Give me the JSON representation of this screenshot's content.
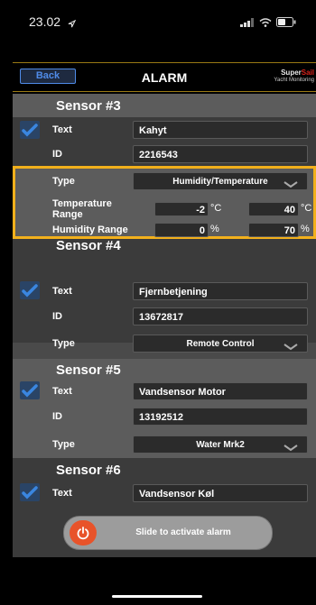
{
  "status": {
    "time": "23.02"
  },
  "nav": {
    "back_label": "Back",
    "title": "ALARM",
    "logo_super": "Super",
    "logo_sail": "Sail",
    "logo_sub": "Yacht Monitoring"
  },
  "sensors": [
    {
      "title": "Sensor #3",
      "text_label": "Text",
      "text_value": "Kahyt",
      "id_label": "ID",
      "id_value": "2216543",
      "type_label": "Type",
      "type_value": "Humidity/Temperature",
      "temp_label": "Temperature Range",
      "temp_min": "-2",
      "temp_max": "40",
      "temp_unit": "°C",
      "hum_label": "Humidity Range",
      "hum_min": "0",
      "hum_max": "70",
      "hum_unit": "%"
    },
    {
      "title": "Sensor #4",
      "text_label": "Text",
      "text_value": "Fjernbetjening",
      "id_label": "ID",
      "id_value": "13672817",
      "type_label": "Type",
      "type_value": "Remote Control"
    },
    {
      "title": "Sensor #5",
      "text_label": "Text",
      "text_value": "Vandsensor Motor",
      "id_label": "ID",
      "id_value": "13192512",
      "type_label": "Type",
      "type_value": "Water Mrk2"
    },
    {
      "title": "Sensor #6",
      "text_label": "Text",
      "text_value": "Vandsensor Køl"
    }
  ],
  "slider": {
    "label": "Slide to activate alarm"
  },
  "colors": {
    "accent_gold": "#f2b01c",
    "check_blue": "#3a86e0",
    "slider_knob": "#e8532a"
  },
  "icons": {
    "checkbox": "check-icon",
    "dropdown": "chevron-down-icon",
    "power": "power-icon"
  }
}
